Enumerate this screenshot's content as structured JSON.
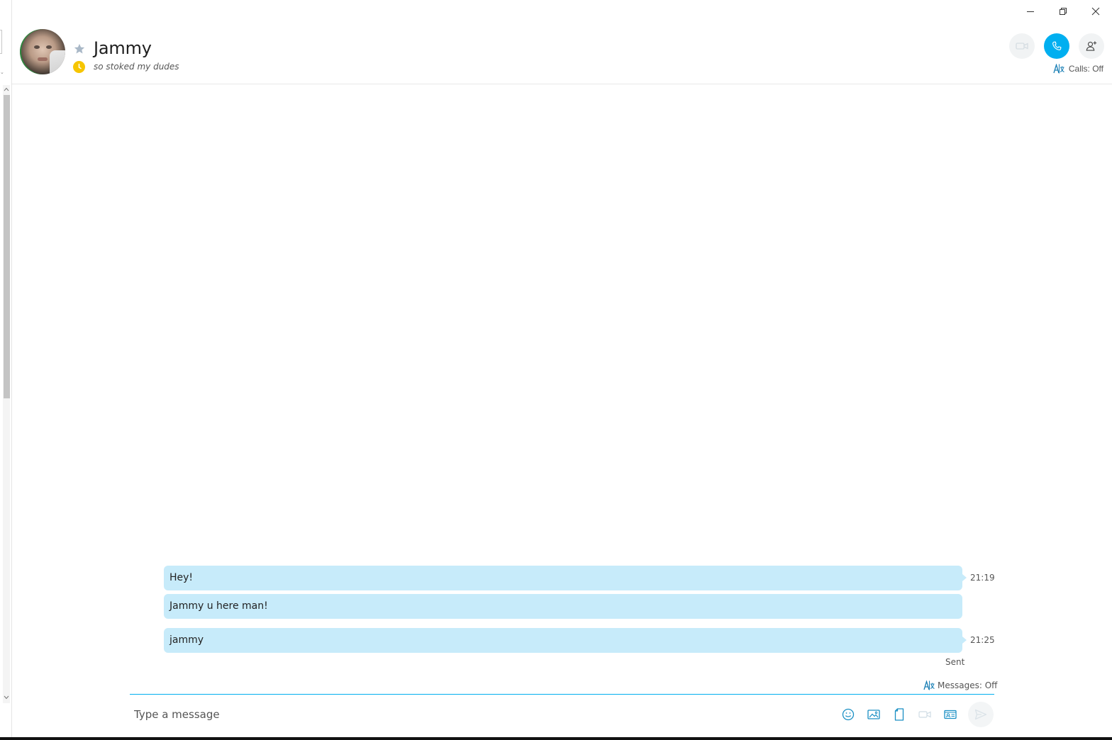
{
  "window": {
    "controls": [
      {
        "name": "minimize",
        "icon": "minimize-icon"
      },
      {
        "name": "restore",
        "icon": "restore-icon"
      },
      {
        "name": "close",
        "icon": "close-icon"
      }
    ]
  },
  "contact": {
    "name": "Jammy",
    "mood": "so stoked my dudes",
    "status_color": "#f6c500",
    "favorite_icon": "star-icon"
  },
  "header": {
    "actions": [
      {
        "name": "video-call",
        "icon": "video-camera-icon",
        "enabled": false
      },
      {
        "name": "audio-call",
        "icon": "phone-icon",
        "enabled": true,
        "color": "#00aff0"
      },
      {
        "name": "add-people",
        "icon": "add-person-icon",
        "enabled": true
      }
    ],
    "calls_translator": "Calls: Off"
  },
  "messages": [
    {
      "text": "Hey!",
      "time": "21:19"
    },
    {
      "text": "Jammy u here man!",
      "time": ""
    },
    {
      "text": "jammy",
      "time": "21:25"
    }
  ],
  "delivery_status": "Sent",
  "messages_translator": "Messages: Off",
  "compose": {
    "placeholder": "Type a message",
    "tools": [
      {
        "name": "emoticons",
        "icon": "smiley-icon"
      },
      {
        "name": "send-image",
        "icon": "image-icon"
      },
      {
        "name": "send-file",
        "icon": "file-icon"
      },
      {
        "name": "video-message",
        "icon": "video-camera-icon"
      },
      {
        "name": "send-contact",
        "icon": "contact-card-icon"
      }
    ],
    "send_icon": "send-icon"
  },
  "colors": {
    "accent": "#00aff0",
    "bubble": "#c7ebfa"
  }
}
